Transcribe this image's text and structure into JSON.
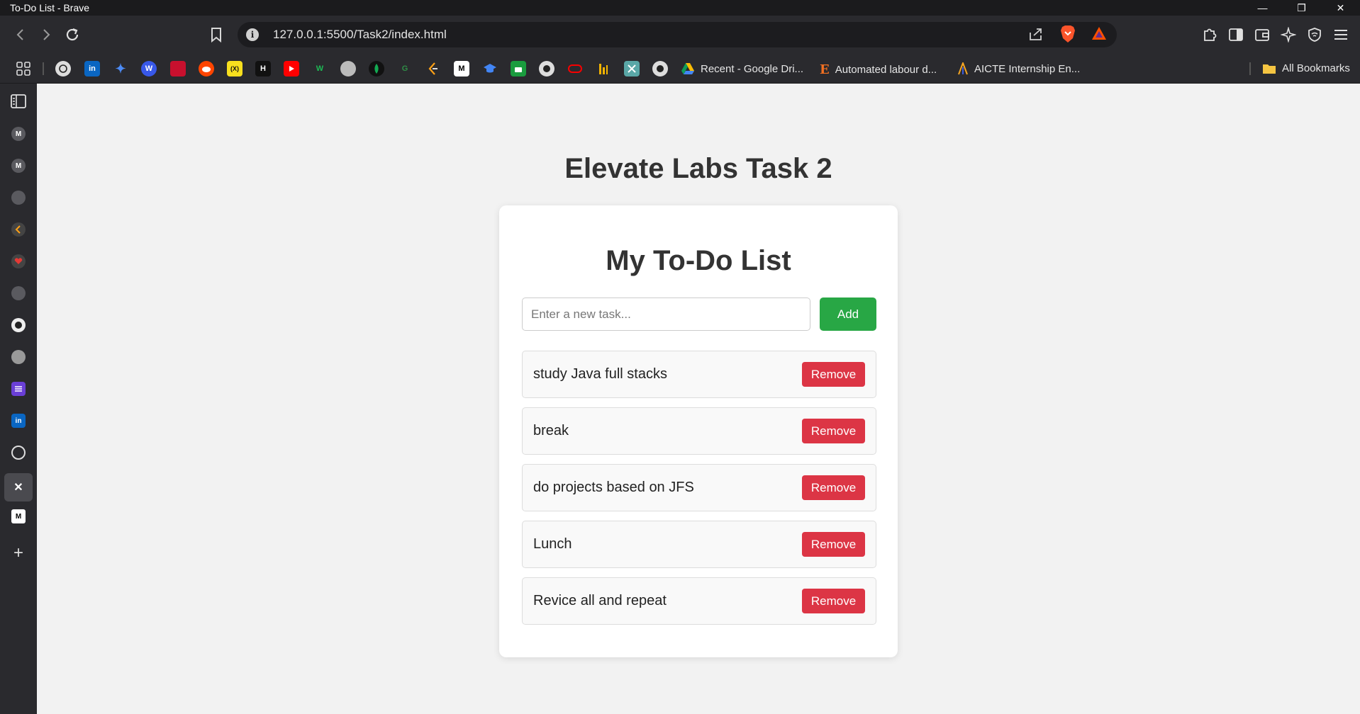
{
  "window": {
    "title": "To-Do List - Brave",
    "minimize": "—",
    "restore": "❐",
    "close": "✕"
  },
  "toolbar": {
    "url": "127.0.0.1:5500/Task2/index.html",
    "info_glyph": "i"
  },
  "bookmarks": {
    "items": [
      {
        "label": "Recent - Google Dri...",
        "icon": "google-drive-icon"
      },
      {
        "label": "Automated labour d...",
        "icon": "e-letter-icon",
        "glyph": "E"
      },
      {
        "label": "AICTE Internship En...",
        "icon": "aicte-icon"
      }
    ],
    "all_label": "All Bookmarks",
    "icon_glyphs": {
      "linkedin": "in",
      "wordpress": "W",
      "xai": "(X)",
      "hashnode": "H",
      "webflow": "W",
      "geeksforgeeks": "G",
      "medium": "M"
    }
  },
  "sidepanel": {
    "close_glyph": "✕",
    "add_glyph": "+",
    "medium_glyph": "M",
    "linkedin_glyph": "in"
  },
  "page": {
    "title": "Elevate Labs Task 2",
    "card_title": "My To-Do List",
    "input_placeholder": "Enter a new task...",
    "input_value": "",
    "add_label": "Add",
    "tasks": [
      {
        "text": "study Java full stacks",
        "remove_label": "Remove"
      },
      {
        "text": "break",
        "remove_label": "Remove"
      },
      {
        "text": "do projects based on JFS",
        "remove_label": "Remove"
      },
      {
        "text": "Lunch",
        "remove_label": "Remove"
      },
      {
        "text": "Revice all and repeat",
        "remove_label": "Remove"
      }
    ]
  },
  "colors": {
    "add_button": "#28a745",
    "remove_button": "#dc3545",
    "page_bg": "#f2f2f2",
    "chrome_bg": "#2a2a2e"
  }
}
